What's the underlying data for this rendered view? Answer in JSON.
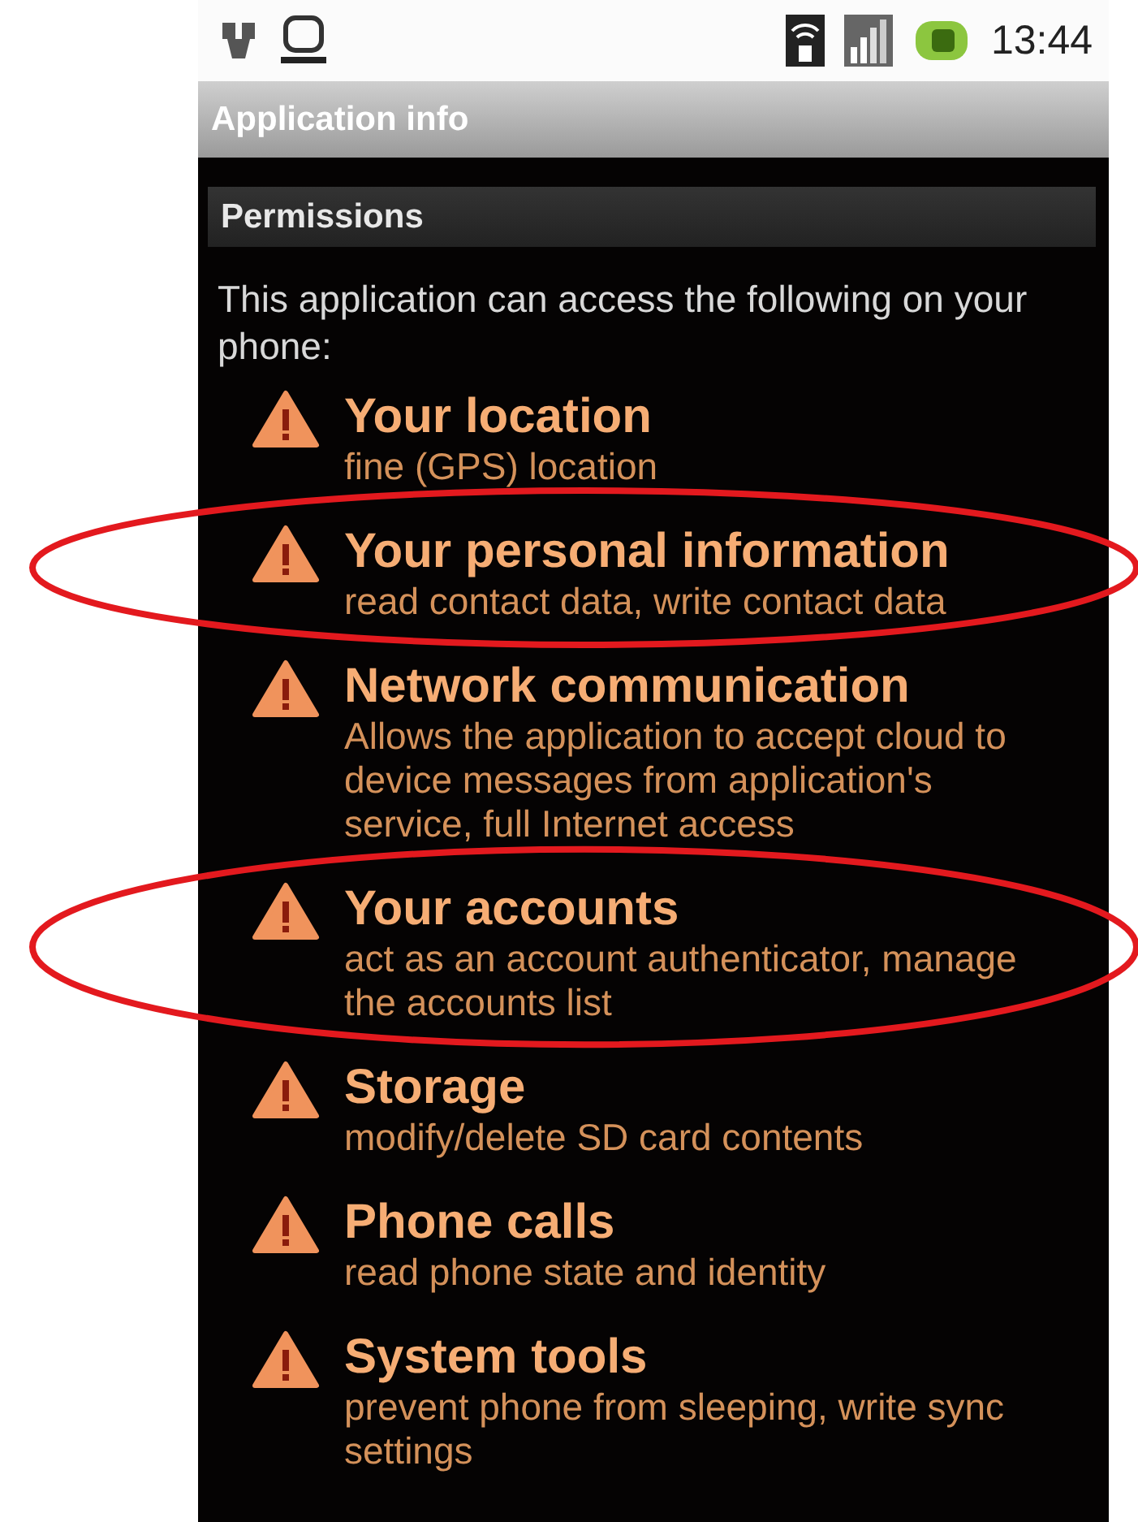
{
  "status_bar": {
    "time": "13:44"
  },
  "title": "Application info",
  "section": {
    "title": "Permissions"
  },
  "description": "This application can access the following on your phone:",
  "permissions": [
    {
      "title": "Your location",
      "detail": "fine (GPS) location",
      "circled": false
    },
    {
      "title": "Your personal information",
      "detail": "read contact data, write contact data",
      "circled": true
    },
    {
      "title": "Network communication",
      "detail": "Allows the application to accept cloud to device messages from application's service, full Internet access",
      "circled": false
    },
    {
      "title": "Your accounts",
      "detail": "act as an account authenticator, manage the accounts list",
      "circled": true
    },
    {
      "title": "Storage",
      "detail": "modify/delete SD card contents",
      "circled": false
    },
    {
      "title": "Phone calls",
      "detail": "read phone state and identity",
      "circled": false
    },
    {
      "title": "System tools",
      "detail": "prevent phone from sleeping, write sync settings",
      "circled": false
    }
  ]
}
